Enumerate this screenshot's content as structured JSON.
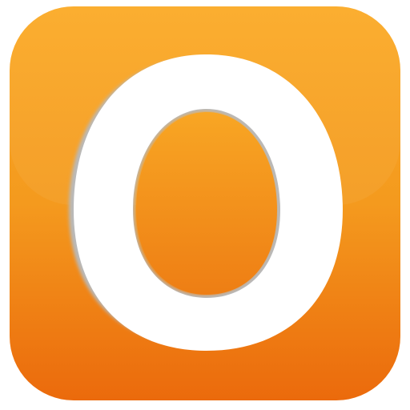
{
  "icon": {
    "glyph": "O",
    "colors": {
      "orange_light": "#FBAA25",
      "orange_mid": "#F49A1E",
      "orange_dark": "#EB6A0C",
      "ring": "#FFFFFF",
      "ring_shadow": "#B9B9B9"
    }
  }
}
